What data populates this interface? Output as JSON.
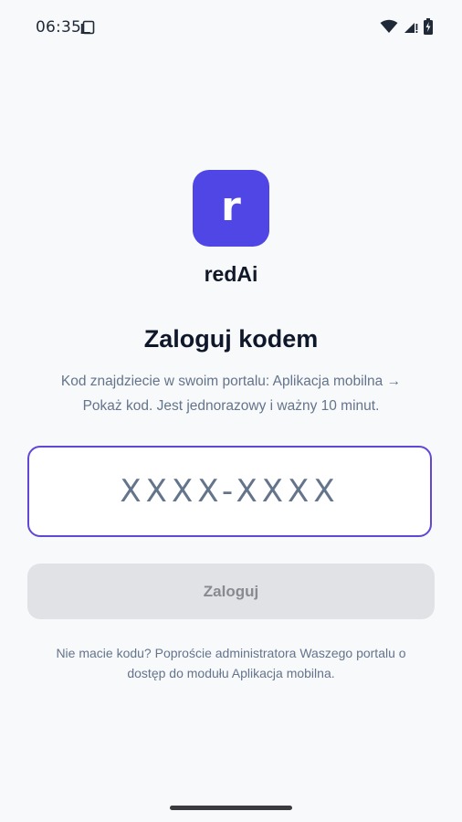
{
  "status_bar": {
    "time": "06:35",
    "icons": [
      "sim-card-icon",
      "wifi-icon",
      "signal-icon",
      "battery-charging-icon"
    ]
  },
  "app": {
    "logo_letter": "r",
    "name": "redAi",
    "accent_color": "#4f46e5"
  },
  "login": {
    "title": "Zaloguj kodem",
    "subtitle_line1": "Kod znajdziecie w swoim portalu: Aplikacja mobilna →",
    "subtitle_line2": "Pokaż kod. Jest jednorazowy i ważny 10 minut.",
    "code_placeholder": "XXXX-XXXX",
    "code_value": "",
    "submit_label": "Zaloguj",
    "help_line1": "Nie macie kodu? Poproście administratora Waszego portalu o",
    "help_line2": "dostęp do modułu Aplikacja mobilna."
  }
}
